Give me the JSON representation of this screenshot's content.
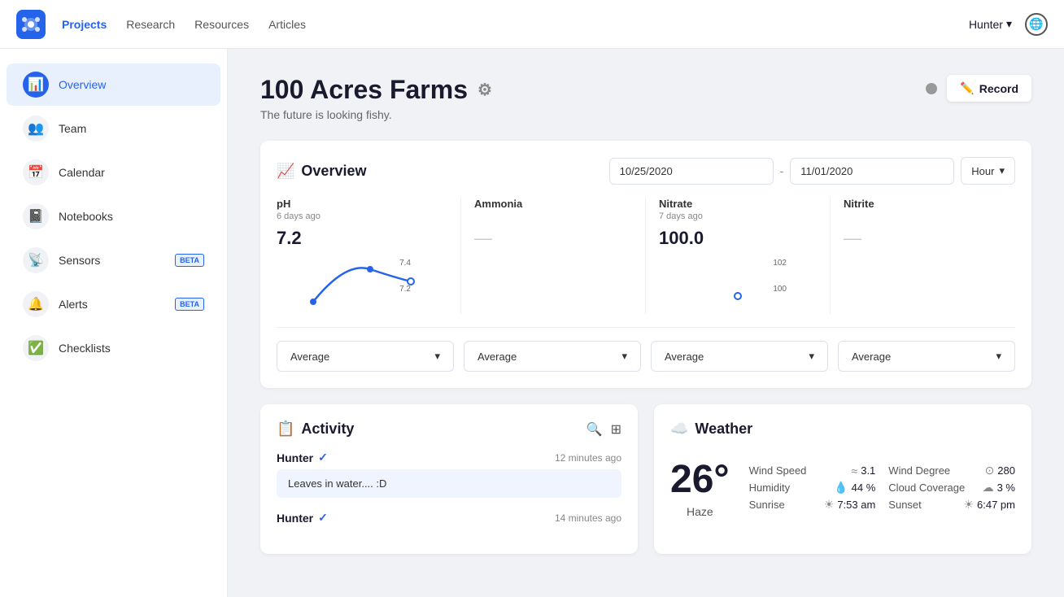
{
  "nav": {
    "links": [
      {
        "label": "Projects",
        "active": true
      },
      {
        "label": "Research",
        "active": false
      },
      {
        "label": "Resources",
        "active": false
      },
      {
        "label": "Articles",
        "active": false
      }
    ],
    "user": "Hunter",
    "globe_icon": "🌐"
  },
  "sidebar": {
    "items": [
      {
        "label": "Overview",
        "icon": "📊",
        "active": true,
        "beta": false
      },
      {
        "label": "Team",
        "icon": "👥",
        "active": false,
        "beta": false
      },
      {
        "label": "Calendar",
        "icon": "📅",
        "active": false,
        "beta": false
      },
      {
        "label": "Notebooks",
        "icon": "📓",
        "active": false,
        "beta": false
      },
      {
        "label": "Sensors",
        "icon": "📡",
        "active": false,
        "beta": true
      },
      {
        "label": "Alerts",
        "icon": "🔔",
        "active": false,
        "beta": true
      },
      {
        "label": "Checklists",
        "icon": "✅",
        "active": false,
        "beta": false
      }
    ]
  },
  "page": {
    "title": "100 Acres Farms",
    "subtitle": "The future is looking fishy.",
    "record_label": "Record"
  },
  "overview": {
    "section_label": "Overview",
    "date_from": "10/25/2020",
    "date_to": "11/01/2020",
    "interval": "Hour",
    "metrics": [
      {
        "label": "pH",
        "time": "6 days ago",
        "value": "7.2",
        "show_dash": false
      },
      {
        "label": "Ammonia",
        "time": "",
        "value": "—",
        "show_dash": true
      },
      {
        "label": "Nitrate",
        "time": "7 days ago",
        "value": "100.0",
        "show_dash": false
      },
      {
        "label": "Nitrite",
        "time": "",
        "value": "—",
        "show_dash": true
      }
    ],
    "dropdowns": [
      "Average",
      "Average",
      "Average",
      "Average"
    ]
  },
  "activity": {
    "section_label": "Activity",
    "entries": [
      {
        "user": "Hunter",
        "time": "12 minutes ago",
        "content": "Leaves in water.... :D"
      },
      {
        "user": "Hunter",
        "time": "14 minutes ago",
        "content": ""
      }
    ]
  },
  "weather": {
    "section_label": "Weather",
    "temperature": "26°",
    "condition": "Haze",
    "details": [
      {
        "key": "Wind Speed",
        "icon": "≈",
        "value": "3.1"
      },
      {
        "key": "Wind Degree",
        "icon": "⊙",
        "value": "280"
      },
      {
        "key": "Humidity",
        "icon": "💧",
        "value": "44 %"
      },
      {
        "key": "Cloud Coverage",
        "icon": "☁",
        "value": "3 %"
      },
      {
        "key": "Sunrise",
        "icon": "☀",
        "value": "7:53 am"
      },
      {
        "key": "Sunset",
        "icon": "☀",
        "value": "6:47 pm"
      }
    ]
  }
}
